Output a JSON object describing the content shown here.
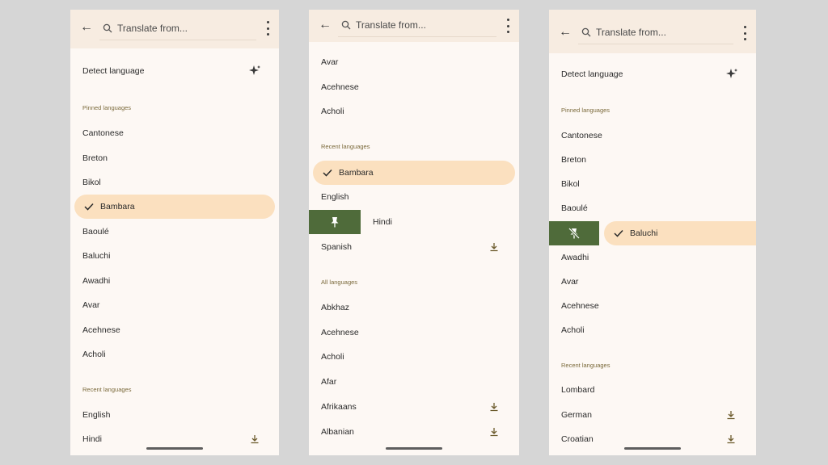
{
  "search": {
    "placeholder": "Translate from..."
  },
  "panel1": {
    "detect_label": "Detect language",
    "pinned_heading": "Pinned languages",
    "pinned": [
      "Cantonese",
      "Breton",
      "Bikol"
    ],
    "selected": "Bambara",
    "more": [
      "Baoulé",
      "Baluchi",
      "Awadhi",
      "Avar",
      "Acehnese",
      "Acholi"
    ],
    "recent_heading": "Recent languages",
    "recent": [
      "English",
      "Hindi"
    ]
  },
  "panel2": {
    "top": [
      "Avar",
      "Acehnese",
      "Acholi"
    ],
    "recent_heading": "Recent languages",
    "selected": "Bambara",
    "english": "English",
    "hindi": "Hindi",
    "spanish": "Spanish",
    "all_heading": "All languages",
    "all": [
      "Abkhaz",
      "Acehnese",
      "Acholi",
      "Afar",
      "Afrikaans",
      "Albanian"
    ]
  },
  "panel3": {
    "detect_label": "Detect language",
    "pinned_heading": "Pinned languages",
    "pinned": [
      "Cantonese",
      "Breton",
      "Bikol",
      "Baoulé"
    ],
    "selected": "Baluchi",
    "more": [
      "Awadhi",
      "Avar",
      "Acehnese",
      "Acholi"
    ],
    "recent_heading": "Recent languages",
    "recent": [
      "Lombard",
      "German",
      "Croatian"
    ]
  },
  "colors": {
    "background": "#d6d6d6",
    "panel": "#fdf8f4",
    "topbar": "#f7ece1",
    "selected": "#fbe0bf",
    "pin_action": "#4f6b3a",
    "section_heading": "#7b6a3b"
  },
  "icons": [
    "back-arrow-icon",
    "search-icon",
    "more-vert-icon",
    "sparkle-icon",
    "check-icon",
    "pin-icon",
    "unpin-icon",
    "download-icon"
  ]
}
